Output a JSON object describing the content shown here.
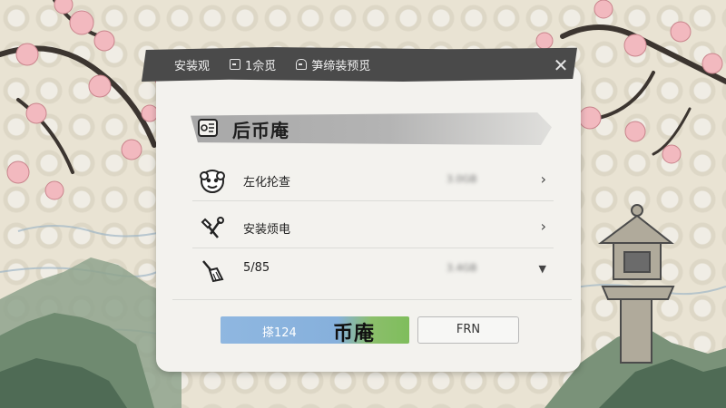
{
  "titlebar": {
    "items": [
      {
        "icon": "none",
        "label": "安装观"
      },
      {
        "icon": "square-icon",
        "label": "1佘觅"
      },
      {
        "icon": "package-icon",
        "label": "笋缔装预觅"
      }
    ],
    "close_label": "✕"
  },
  "section": {
    "title": "后币庵",
    "icon": "puzzle-icon"
  },
  "rows": [
    {
      "icon": "face-mask-icon",
      "label": "左化抡查",
      "value": "3.0GB",
      "indicator": "chevron-right"
    },
    {
      "icon": "tools-icon",
      "label": "安装烦电",
      "value": "",
      "indicator": "chevron-right"
    },
    {
      "icon": "broom-icon",
      "label": "5/85",
      "value": "3.4GB",
      "indicator": "triangle-down"
    }
  ],
  "chevron_right": "›",
  "triangle_down": "▼",
  "buttons": {
    "primary_label": "搽124",
    "primary_overlay": "币庵",
    "secondary_label": "FRN"
  },
  "colors": {
    "titlebar": "#4a4a4a",
    "panel": "#f3f2ee",
    "primary_blue": "#8fb7e0",
    "primary_green": "#7fbd5c",
    "blossom": "#f2b9bf"
  }
}
